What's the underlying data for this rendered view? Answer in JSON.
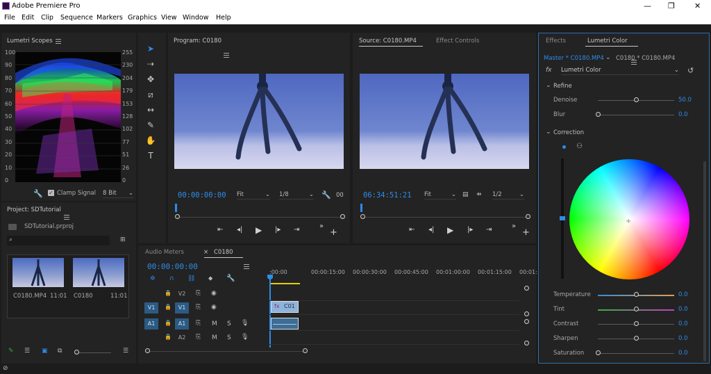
{
  "app": {
    "title": "Adobe Premiere Pro"
  },
  "window_controls": {
    "minimize": "—",
    "maximize": "❐",
    "close": "✕"
  },
  "menu": [
    "File",
    "Edit",
    "Clip",
    "Sequence",
    "Markers",
    "Graphics",
    "View",
    "Window",
    "Help"
  ],
  "scopes": {
    "title": "Lumetri Scopes",
    "left_scale": [
      "100",
      "90",
      "80",
      "70",
      "60",
      "50",
      "40",
      "30",
      "20",
      "10",
      "0"
    ],
    "right_scale": [
      "255",
      "230",
      "204",
      "179",
      "153",
      "128",
      "102",
      "77",
      "51",
      "26",
      "0"
    ],
    "clamp_signal": "Clamp Signal",
    "bit_depth": "8 Bit"
  },
  "project": {
    "title": "Project: SDTutorial",
    "file": "SDTutorial.prproj",
    "items": [
      {
        "name": "C0180.MP4",
        "duration": "11:01"
      },
      {
        "name": "C0180",
        "duration": "11:01"
      }
    ]
  },
  "tools": [
    {
      "name": "selection-tool",
      "glyph": "➤"
    },
    {
      "name": "track-select-tool",
      "glyph": "⇢"
    },
    {
      "name": "ripple-edit-tool",
      "glyph": "✥"
    },
    {
      "name": "razor-tool",
      "glyph": "⧄"
    },
    {
      "name": "slip-tool",
      "glyph": "↔"
    },
    {
      "name": "pen-tool",
      "glyph": "✎"
    },
    {
      "name": "hand-tool",
      "glyph": "✋"
    },
    {
      "name": "type-tool",
      "glyph": "T"
    }
  ],
  "program": {
    "title": "Program: C0180",
    "timecode": "00:00:00:00",
    "zoom": "Fit",
    "resolution": "1/8",
    "end": "00"
  },
  "source": {
    "title": "Source: C0180.MP4",
    "effect_controls": "Effect Controls",
    "timecode": "06:34:51:21",
    "zoom": "Fit",
    "resolution": "1/2"
  },
  "timeline": {
    "audio_meters": "Audio Meters",
    "close": "×",
    "sequence": "C0180",
    "timecode": "00:00:00:00",
    "ruler": [
      ":00:00",
      "00:00:15:00",
      "00:00:30:00",
      "00:00:45:00",
      "00:01:00:00",
      "00:01:15:00",
      "00:01:"
    ],
    "tracks": [
      {
        "src": "",
        "name": "V2",
        "mute": "",
        "solo": ""
      },
      {
        "src": "V1",
        "name": "V1",
        "mute": "",
        "solo": ""
      },
      {
        "src": "A1",
        "name": "A1",
        "mute": "M",
        "solo": "S"
      },
      {
        "src": "",
        "name": "A2",
        "mute": "M",
        "solo": "S"
      }
    ],
    "clip_label": "C01"
  },
  "effects_panel": {
    "tab_effects": "Effects",
    "tab_lumetri": "Lumetri Color",
    "master": "Master * C0180.MP4",
    "sequence_clip": "C0180 * C0180.MP4",
    "fx": "fx",
    "effect_name": "Lumetri Color",
    "refine": "Refine",
    "correction": "Correction",
    "refine_controls": [
      {
        "label": "Denoise",
        "value": "50.0",
        "level": 0.5
      },
      {
        "label": "Blur",
        "value": "0.0",
        "level": 0.0
      }
    ],
    "correction_controls": [
      {
        "label": "Temperature",
        "value": "0.0",
        "level": 0.5
      },
      {
        "label": "Tint",
        "value": "0.0",
        "level": 0.5
      },
      {
        "label": "Contrast",
        "value": "0.0",
        "level": 0.5
      },
      {
        "label": "Sharpen",
        "value": "0.0",
        "level": 0.5
      },
      {
        "label": "Saturation",
        "value": "0.0",
        "level": 0.0
      }
    ]
  }
}
